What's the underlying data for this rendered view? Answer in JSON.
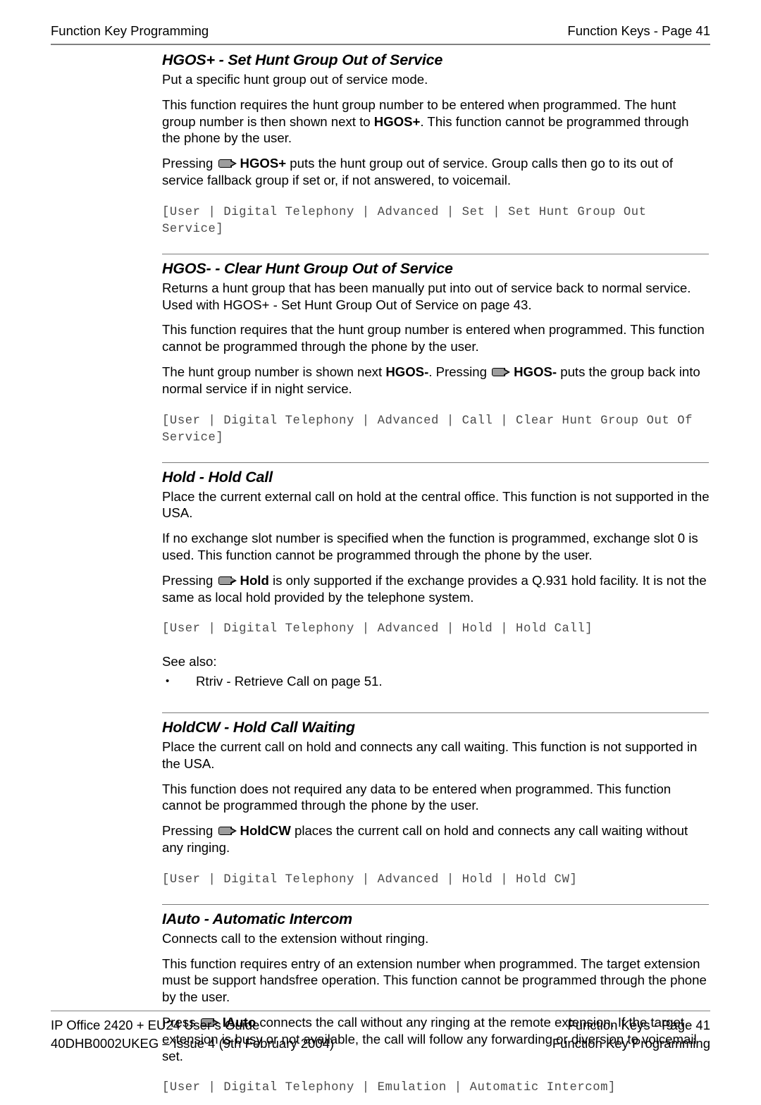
{
  "header": {
    "left": "Function Key Programming",
    "right": "Function Keys - Page 41"
  },
  "footer": {
    "left_line1": "IP Office 2420 + EU24 User’s Guide",
    "left_line2": "40DHB0002UKEG – Issue 4 (9th February 2004)",
    "right_line1": "Function Keys - Page 41",
    "right_line2": "Function Key Programming"
  },
  "sections": {
    "hgos_plus": {
      "title": "HGOS+ - Set Hunt Group Out of Service",
      "p1": "Put a specific hunt group out of service mode.",
      "p2_a": "This function requires the hunt group number to be entered when programmed. The hunt group number is then shown next to ",
      "p2_bold": "HGOS+",
      "p2_b": ". This function cannot be programmed through the phone by the user.",
      "p3_pre": "Pressing ",
      "p3_bold": "HGOS+",
      "p3_post": " puts the hunt group out of service. Group calls then go to its out of service fallback group if set or, if not answered, to voicemail.",
      "path": "[User | Digital Telephony | Advanced | Set | Set Hunt Group Out Service]"
    },
    "hgos_minus": {
      "title": "HGOS- - Clear Hunt Group Out of Service",
      "p1": "Returns a hunt group that has been manually put into out of service back to normal service. Used with HGOS+ - Set Hunt Group Out of Service on page 43.",
      "p2": "This function requires that the hunt group number is entered when programmed. This function cannot be programmed through the phone by the user.",
      "p3_pre": "The hunt group number is shown next ",
      "p3_bold1": "HGOS-",
      "p3_mid": ". Pressing ",
      "p3_bold2": "HGOS-",
      "p3_post": " puts the group back into normal service if in night service.",
      "path": "[User | Digital Telephony | Advanced | Call | Clear Hunt Group Out Of Service]"
    },
    "hold": {
      "title": "Hold - Hold Call",
      "p1": "Place the current external call on hold at the central office. This function is not supported in the USA.",
      "p2": "If no exchange slot number is specified when the function is programmed, exchange slot 0 is used. This function cannot be programmed through the phone by the user.",
      "p3_pre": "Pressing ",
      "p3_bold": "Hold",
      "p3_post": " is only supported if the exchange provides a Q.931 hold facility. It is not the same as local hold provided by the telephone system.",
      "path": "[User | Digital Telephony | Advanced | Hold | Hold Call]",
      "see_also_label": "See also:",
      "see_also_items": [
        "Rtriv - Retrieve Call on page 51."
      ]
    },
    "holdcw": {
      "title": "HoldCW - Hold Call Waiting",
      "p1": "Place the current call on hold and connects any call waiting. This function is not supported in the USA.",
      "p2": "This function does not required any data to be entered when programmed. This function cannot be programmed through the phone by the user.",
      "p3_pre": "Pressing ",
      "p3_bold": "HoldCW",
      "p3_post": " places the current call on hold and connects any call waiting without any ringing.",
      "path": "[User | Digital Telephony | Advanced | Hold | Hold CW]"
    },
    "iauto": {
      "title": "IAuto - Automatic Intercom",
      "p1": "Connects call to the extension without ringing.",
      "p2": "This function requires entry of an extension number when programmed. The target extension must be support handsfree operation. This function cannot be programmed through the phone by the user.",
      "p3_pre": "Press ",
      "p3_bold": "IAuto",
      "p3_post": " connects the call without any ringing at the remote extension. If the target extension is busy or not available, the call will follow any forwarding or diversion to voicemail set.",
      "path": "[User | Digital Telephony | Emulation | Automatic Intercom]"
    }
  },
  "icons": {
    "function_key": "phone-function-key-icon",
    "bullet": "•"
  }
}
